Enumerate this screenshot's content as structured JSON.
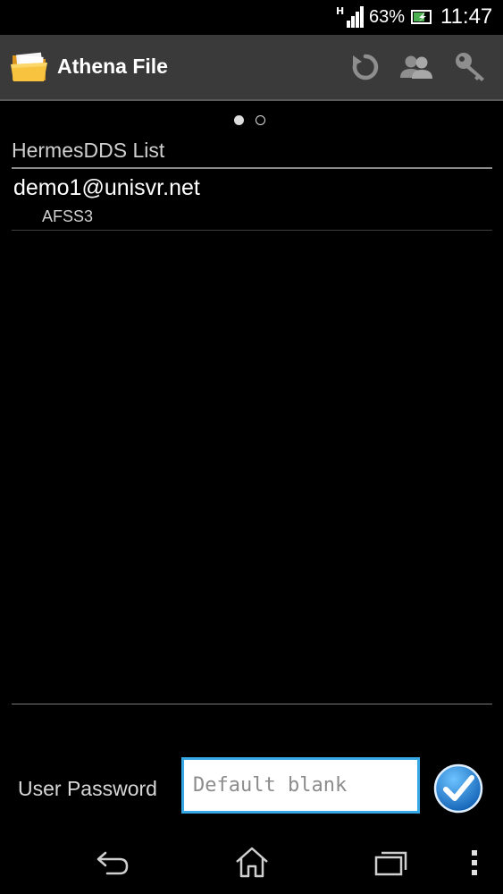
{
  "status_bar": {
    "network": "H",
    "battery_percent": "63%",
    "time": "11:47"
  },
  "action_bar": {
    "title": "Athena File",
    "icons": [
      "folder-app-icon",
      "refresh-icon",
      "users-icon",
      "key-icon"
    ]
  },
  "pager": {
    "pages": 2,
    "current": 1
  },
  "list": {
    "title": "HermesDDS List",
    "items": [
      {
        "title": "demo1@unisvr.net",
        "subtitle": "AFSS3"
      }
    ]
  },
  "password": {
    "label": "User Password",
    "placeholder": "Default blank",
    "value": ""
  },
  "colors": {
    "action_bar": "#3a3a3a",
    "input_border": "#37a8e6",
    "confirm_button": "#1e7ccf"
  },
  "nav_bar": {
    "icons": [
      "back-icon",
      "home-icon",
      "recent-apps-icon",
      "overflow-menu-icon"
    ]
  }
}
